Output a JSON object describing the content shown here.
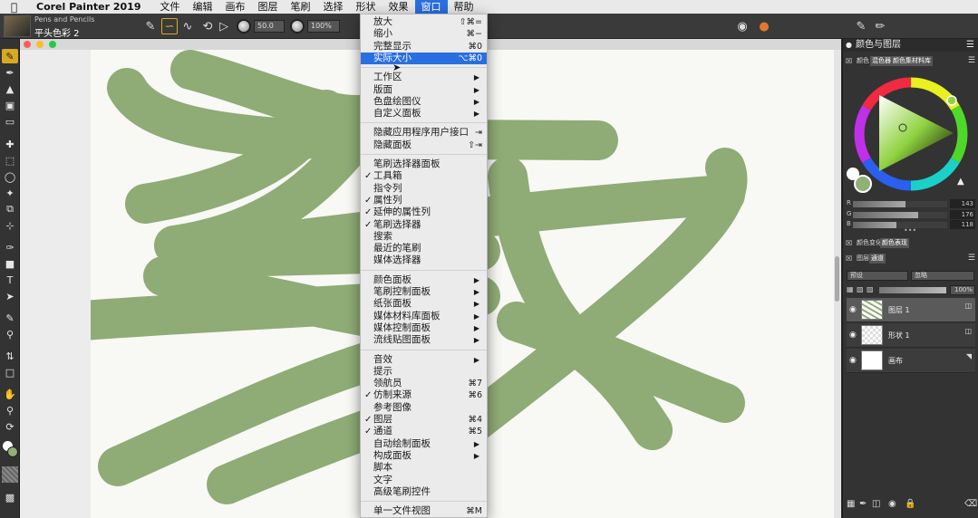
{
  "menubar": {
    "app_name": "Corel Painter 2019",
    "items": [
      "文件",
      "编辑",
      "画布",
      "图层",
      "笔刷",
      "选择",
      "形状",
      "效果",
      "窗口",
      "帮助"
    ],
    "active_index": 8
  },
  "propbar": {
    "brush_category": "Pens and Pencils",
    "brush_variant": "平头色彩 2",
    "size_value": "50.0",
    "opacity_value": "100%"
  },
  "window_menu": {
    "items": [
      {
        "label": "放大",
        "shortcut": "⇧⌘=",
        "type": "item"
      },
      {
        "label": "缩小",
        "shortcut": "⌘−",
        "type": "item"
      },
      {
        "label": "完整显示",
        "shortcut": "⌘0",
        "type": "item"
      },
      {
        "label": "实际大小",
        "shortcut": "⌥⌘0",
        "type": "item",
        "highlight": true
      },
      {
        "type": "sep"
      },
      {
        "label": "工作区",
        "type": "submenu"
      },
      {
        "label": "版面",
        "type": "submenu"
      },
      {
        "label": "色盘绘图仪",
        "type": "submenu"
      },
      {
        "label": "自定义面板",
        "type": "submenu"
      },
      {
        "type": "sep"
      },
      {
        "label": "隐藏应用程序用户接口",
        "shortcut": "⇥",
        "type": "item"
      },
      {
        "label": "隐藏面板",
        "shortcut": "⇧⇥",
        "type": "item"
      },
      {
        "type": "sep"
      },
      {
        "label": "笔刷选择器面板",
        "type": "item"
      },
      {
        "label": "工具箱",
        "type": "item",
        "checked": true
      },
      {
        "label": "指令列",
        "type": "item"
      },
      {
        "label": "属性列",
        "type": "item",
        "checked": true
      },
      {
        "label": "延伸的属性列",
        "type": "item",
        "checked": true
      },
      {
        "label": "笔刷选择器",
        "type": "item",
        "checked": true
      },
      {
        "label": "搜索",
        "type": "item"
      },
      {
        "label": "最近的笔刷",
        "type": "item"
      },
      {
        "label": "媒体选择器",
        "type": "item"
      },
      {
        "type": "sep"
      },
      {
        "label": "颜色面板",
        "type": "submenu"
      },
      {
        "label": "笔刷控制面板",
        "type": "submenu"
      },
      {
        "label": "纸张面板",
        "type": "submenu"
      },
      {
        "label": "媒体材料库面板",
        "type": "submenu"
      },
      {
        "label": "媒体控制面板",
        "type": "submenu"
      },
      {
        "label": "流线贴图面板",
        "type": "submenu"
      },
      {
        "type": "sep"
      },
      {
        "label": "音效",
        "type": "submenu"
      },
      {
        "label": "提示",
        "type": "item"
      },
      {
        "label": "领航员",
        "shortcut": "⌘7",
        "type": "item"
      },
      {
        "label": "仿制来源",
        "shortcut": "⌘6",
        "type": "item",
        "checked": true
      },
      {
        "label": "参考图像",
        "type": "item"
      },
      {
        "label": "图层",
        "shortcut": "⌘4",
        "type": "item",
        "checked": true
      },
      {
        "label": "通道",
        "shortcut": "⌘5",
        "type": "item",
        "checked": true
      },
      {
        "label": "自动绘制面板",
        "type": "submenu"
      },
      {
        "label": "构成面板",
        "type": "submenu"
      },
      {
        "label": "脚本",
        "type": "item"
      },
      {
        "label": "文字",
        "type": "item"
      },
      {
        "label": "高级笔刷控件",
        "type": "item"
      },
      {
        "type": "sep"
      },
      {
        "label": "单一文件视图",
        "shortcut": "⌘M",
        "type": "item"
      }
    ]
  },
  "panel": {
    "title": "颜色与图层",
    "color_tabs": [
      "颜色",
      "混色器",
      "颜色集材料库"
    ],
    "rgb": [
      {
        "label": "R",
        "value": "143"
      },
      {
        "label": "G",
        "value": "176"
      },
      {
        "label": "B",
        "value": "118"
      }
    ],
    "current_color": "#8fb076",
    "variation_tabs": [
      "颜色变化",
      "颜色表现"
    ],
    "layer_tabs": [
      "图层",
      "通道"
    ],
    "composite_method": "预设",
    "composite_depth": "忽略",
    "opacity": "100%",
    "layers": [
      {
        "name": "图层 1",
        "selected": true
      },
      {
        "name": "形状 1",
        "selected": false
      },
      {
        "name": "画布",
        "selected": false
      }
    ]
  },
  "colors": {
    "accent": "#2a6fe0",
    "stroke_green": "#8fab76",
    "tool_selected": "#d9a824"
  }
}
